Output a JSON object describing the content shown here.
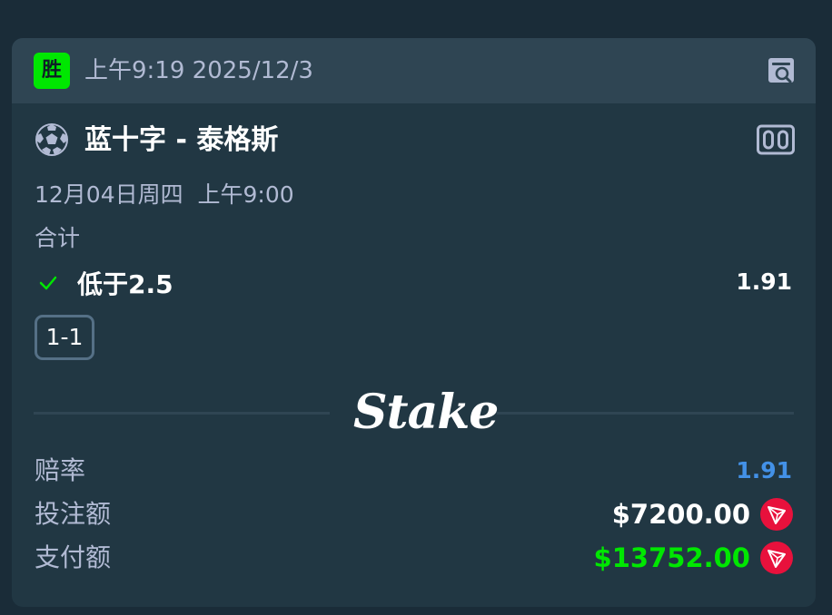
{
  "header": {
    "result_badge": "胜",
    "placed_time": "上午9:19 2025/12/3",
    "search_icon": "receipt-search-icon"
  },
  "match": {
    "sport_icon": "soccer-ball-icon",
    "title": "蓝十字 - 泰格斯",
    "scoreboard_icon": "scoreboard-icon",
    "date": "12月04日周四  上午9:00",
    "market": "合计",
    "selection_icon": "check-icon",
    "selection": "低于2.5",
    "selection_odds": "1.91",
    "score": "1-1"
  },
  "brand": {
    "name": "Stake"
  },
  "summary": {
    "odds_label": "赔率",
    "odds_value": "1.91",
    "stake_label": "投注额",
    "stake_value": "$7200.00",
    "payout_label": "支付额",
    "payout_value": "$13752.00",
    "currency_icon": "tron-icon"
  },
  "colors": {
    "win": "#00e701",
    "odds": "#4391e7",
    "payout": "#00e701",
    "tron": "#e8113c"
  }
}
